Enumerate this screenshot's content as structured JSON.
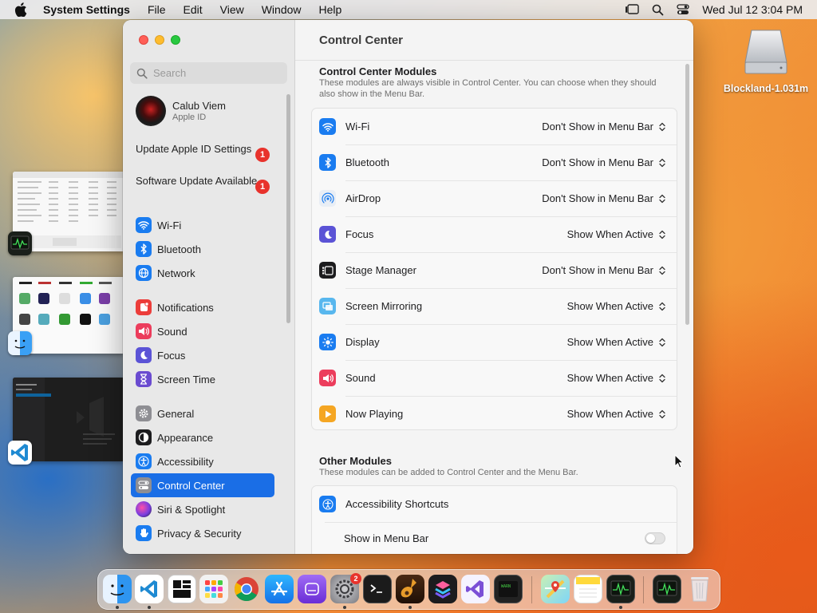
{
  "menubar": {
    "app_name": "System Settings",
    "menus": [
      "File",
      "Edit",
      "View",
      "Window",
      "Help"
    ],
    "clock": "Wed Jul 12  3:04 PM"
  },
  "desktop": {
    "drive_label": "Blockland-1.031m"
  },
  "sidebar": {
    "search_placeholder": "Search",
    "profile": {
      "name": "Calub Viem",
      "subtitle": "Apple ID"
    },
    "notices": [
      {
        "label": "Update Apple ID Settings",
        "badge": "1"
      },
      {
        "label": "Software Update Available",
        "badge": "1"
      }
    ],
    "items": [
      {
        "label": "Wi-Fi",
        "icon": "wifi-icon",
        "color": "#1a7cf0"
      },
      {
        "label": "Bluetooth",
        "icon": "bluetooth-icon",
        "color": "#1a7cf0"
      },
      {
        "label": "Network",
        "icon": "globe-icon",
        "color": "#1a7cf0"
      },
      {
        "label": "Notifications",
        "icon": "bell-icon",
        "color": "#ec3d3a"
      },
      {
        "label": "Sound",
        "icon": "speaker-icon",
        "color": "#ec3d5c"
      },
      {
        "label": "Focus",
        "icon": "moon-icon",
        "color": "#5b53d6"
      },
      {
        "label": "Screen Time",
        "icon": "hourglass-icon",
        "color": "#6a4bd0"
      },
      {
        "label": "General",
        "icon": "gear-icon",
        "color": "#8e8e93"
      },
      {
        "label": "Appearance",
        "icon": "appearance-icon",
        "color": "#1c1c1e"
      },
      {
        "label": "Accessibility",
        "icon": "accessibility-icon",
        "color": "#1a7cf0"
      },
      {
        "label": "Control Center",
        "icon": "control-center-icon",
        "color": "#8e8e93"
      },
      {
        "label": "Siri & Spotlight",
        "icon": "siri-icon",
        "color": "#b84ad8"
      },
      {
        "label": "Privacy & Security",
        "icon": "hand-icon",
        "color": "#1a7cf0"
      }
    ],
    "selected": "Control Center"
  },
  "content": {
    "title": "Control Center",
    "modules_section": {
      "title": "Control Center Modules",
      "description": "These modules are always visible in Control Center. You can choose when they should also show in the Menu Bar.",
      "rows": [
        {
          "label": "Wi-Fi",
          "value": "Don't Show in Menu Bar",
          "icon": "wifi-icon",
          "color": "#1a7cf0"
        },
        {
          "label": "Bluetooth",
          "value": "Don't Show in Menu Bar",
          "icon": "bluetooth-icon",
          "color": "#1a7cf0"
        },
        {
          "label": "AirDrop",
          "value": "Don't Show in Menu Bar",
          "icon": "airdrop-icon",
          "color": "#e9eef5"
        },
        {
          "label": "Focus",
          "value": "Show When Active",
          "icon": "moon-icon",
          "color": "#5b53d6"
        },
        {
          "label": "Stage Manager",
          "value": "Don't Show in Menu Bar",
          "icon": "stage-manager-icon",
          "color": "#1c1c1e"
        },
        {
          "label": "Screen Mirroring",
          "value": "Show When Active",
          "icon": "screen-mirroring-icon",
          "color": "#58b7ee"
        },
        {
          "label": "Display",
          "value": "Show When Active",
          "icon": "sun-icon",
          "color": "#1a7cf0"
        },
        {
          "label": "Sound",
          "value": "Show When Active",
          "icon": "speaker-icon",
          "color": "#ec3d5c"
        },
        {
          "label": "Now Playing",
          "value": "Show When Active",
          "icon": "play-icon",
          "color": "#f5a623"
        }
      ]
    },
    "other_section": {
      "title": "Other Modules",
      "description": "These modules can be added to Control Center and the Menu Bar.",
      "module": {
        "label": "Accessibility Shortcuts",
        "icon": "accessibility-icon",
        "color": "#1a7cf0"
      },
      "toggle_label": "Show in Menu Bar",
      "toggle_on": false
    }
  },
  "dock": {
    "apps": [
      "finder-icon",
      "vscode-icon",
      "window-manager-icon",
      "launchpad-icon",
      "chrome-icon",
      "app-store-icon",
      "podcasts-icon",
      "system-settings-icon",
      "terminal-icon",
      "garageband-icon",
      "shortcuts-icon",
      "visual-studio-icon",
      "console-icon",
      "maps-icon",
      "notes-icon",
      "activity-monitor-icon",
      "activity-monitor-recent-icon",
      "trash-icon"
    ],
    "settings_badge": "2"
  }
}
